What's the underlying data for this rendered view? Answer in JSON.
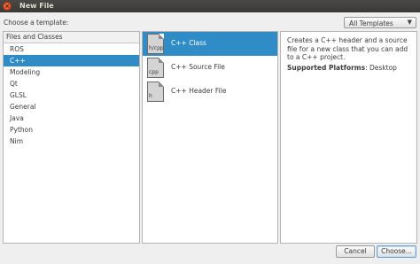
{
  "window": {
    "title": "New File",
    "close_glyph": "×"
  },
  "template_prompt": "Choose a template:",
  "filter": {
    "selected": "All Templates",
    "arrow": "▼"
  },
  "categories": {
    "header": "Files and Classes",
    "items": [
      "ROS",
      "C++",
      "Modeling",
      "Qt",
      "GLSL",
      "General",
      "Java",
      "Python",
      "Nim"
    ],
    "selected_index": 1
  },
  "templates": [
    {
      "label": "C++ Class",
      "icon_text": "h/cpp",
      "selected": true
    },
    {
      "label": "C++ Source File",
      "icon_text": "cpp",
      "selected": false
    },
    {
      "label": "C++ Header File",
      "icon_text": "h",
      "selected": false
    }
  ],
  "description": {
    "text": "Creates a C++ header and a source file for a new class that you can add to a C++ project.",
    "platforms_label": "Supported Platforms",
    "platforms_value": ": Desktop"
  },
  "buttons": {
    "cancel": "Cancel",
    "choose": "Choose..."
  },
  "colors": {
    "selection": "#308cc6",
    "titlebar": "#3c3b37"
  }
}
